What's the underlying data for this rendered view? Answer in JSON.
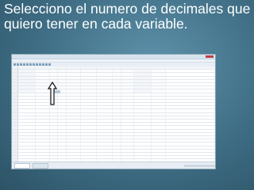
{
  "slide": {
    "title": "Selecciono el numero de decimales que quiero tener en cada variable."
  },
  "window": {
    "title": "",
    "accent": "#d7e4f0"
  },
  "colors": {
    "background": "#3f6f86",
    "text": "#ffffff",
    "arrow": "#111111"
  },
  "icons": {
    "pointer": "up-arrow-icon"
  }
}
